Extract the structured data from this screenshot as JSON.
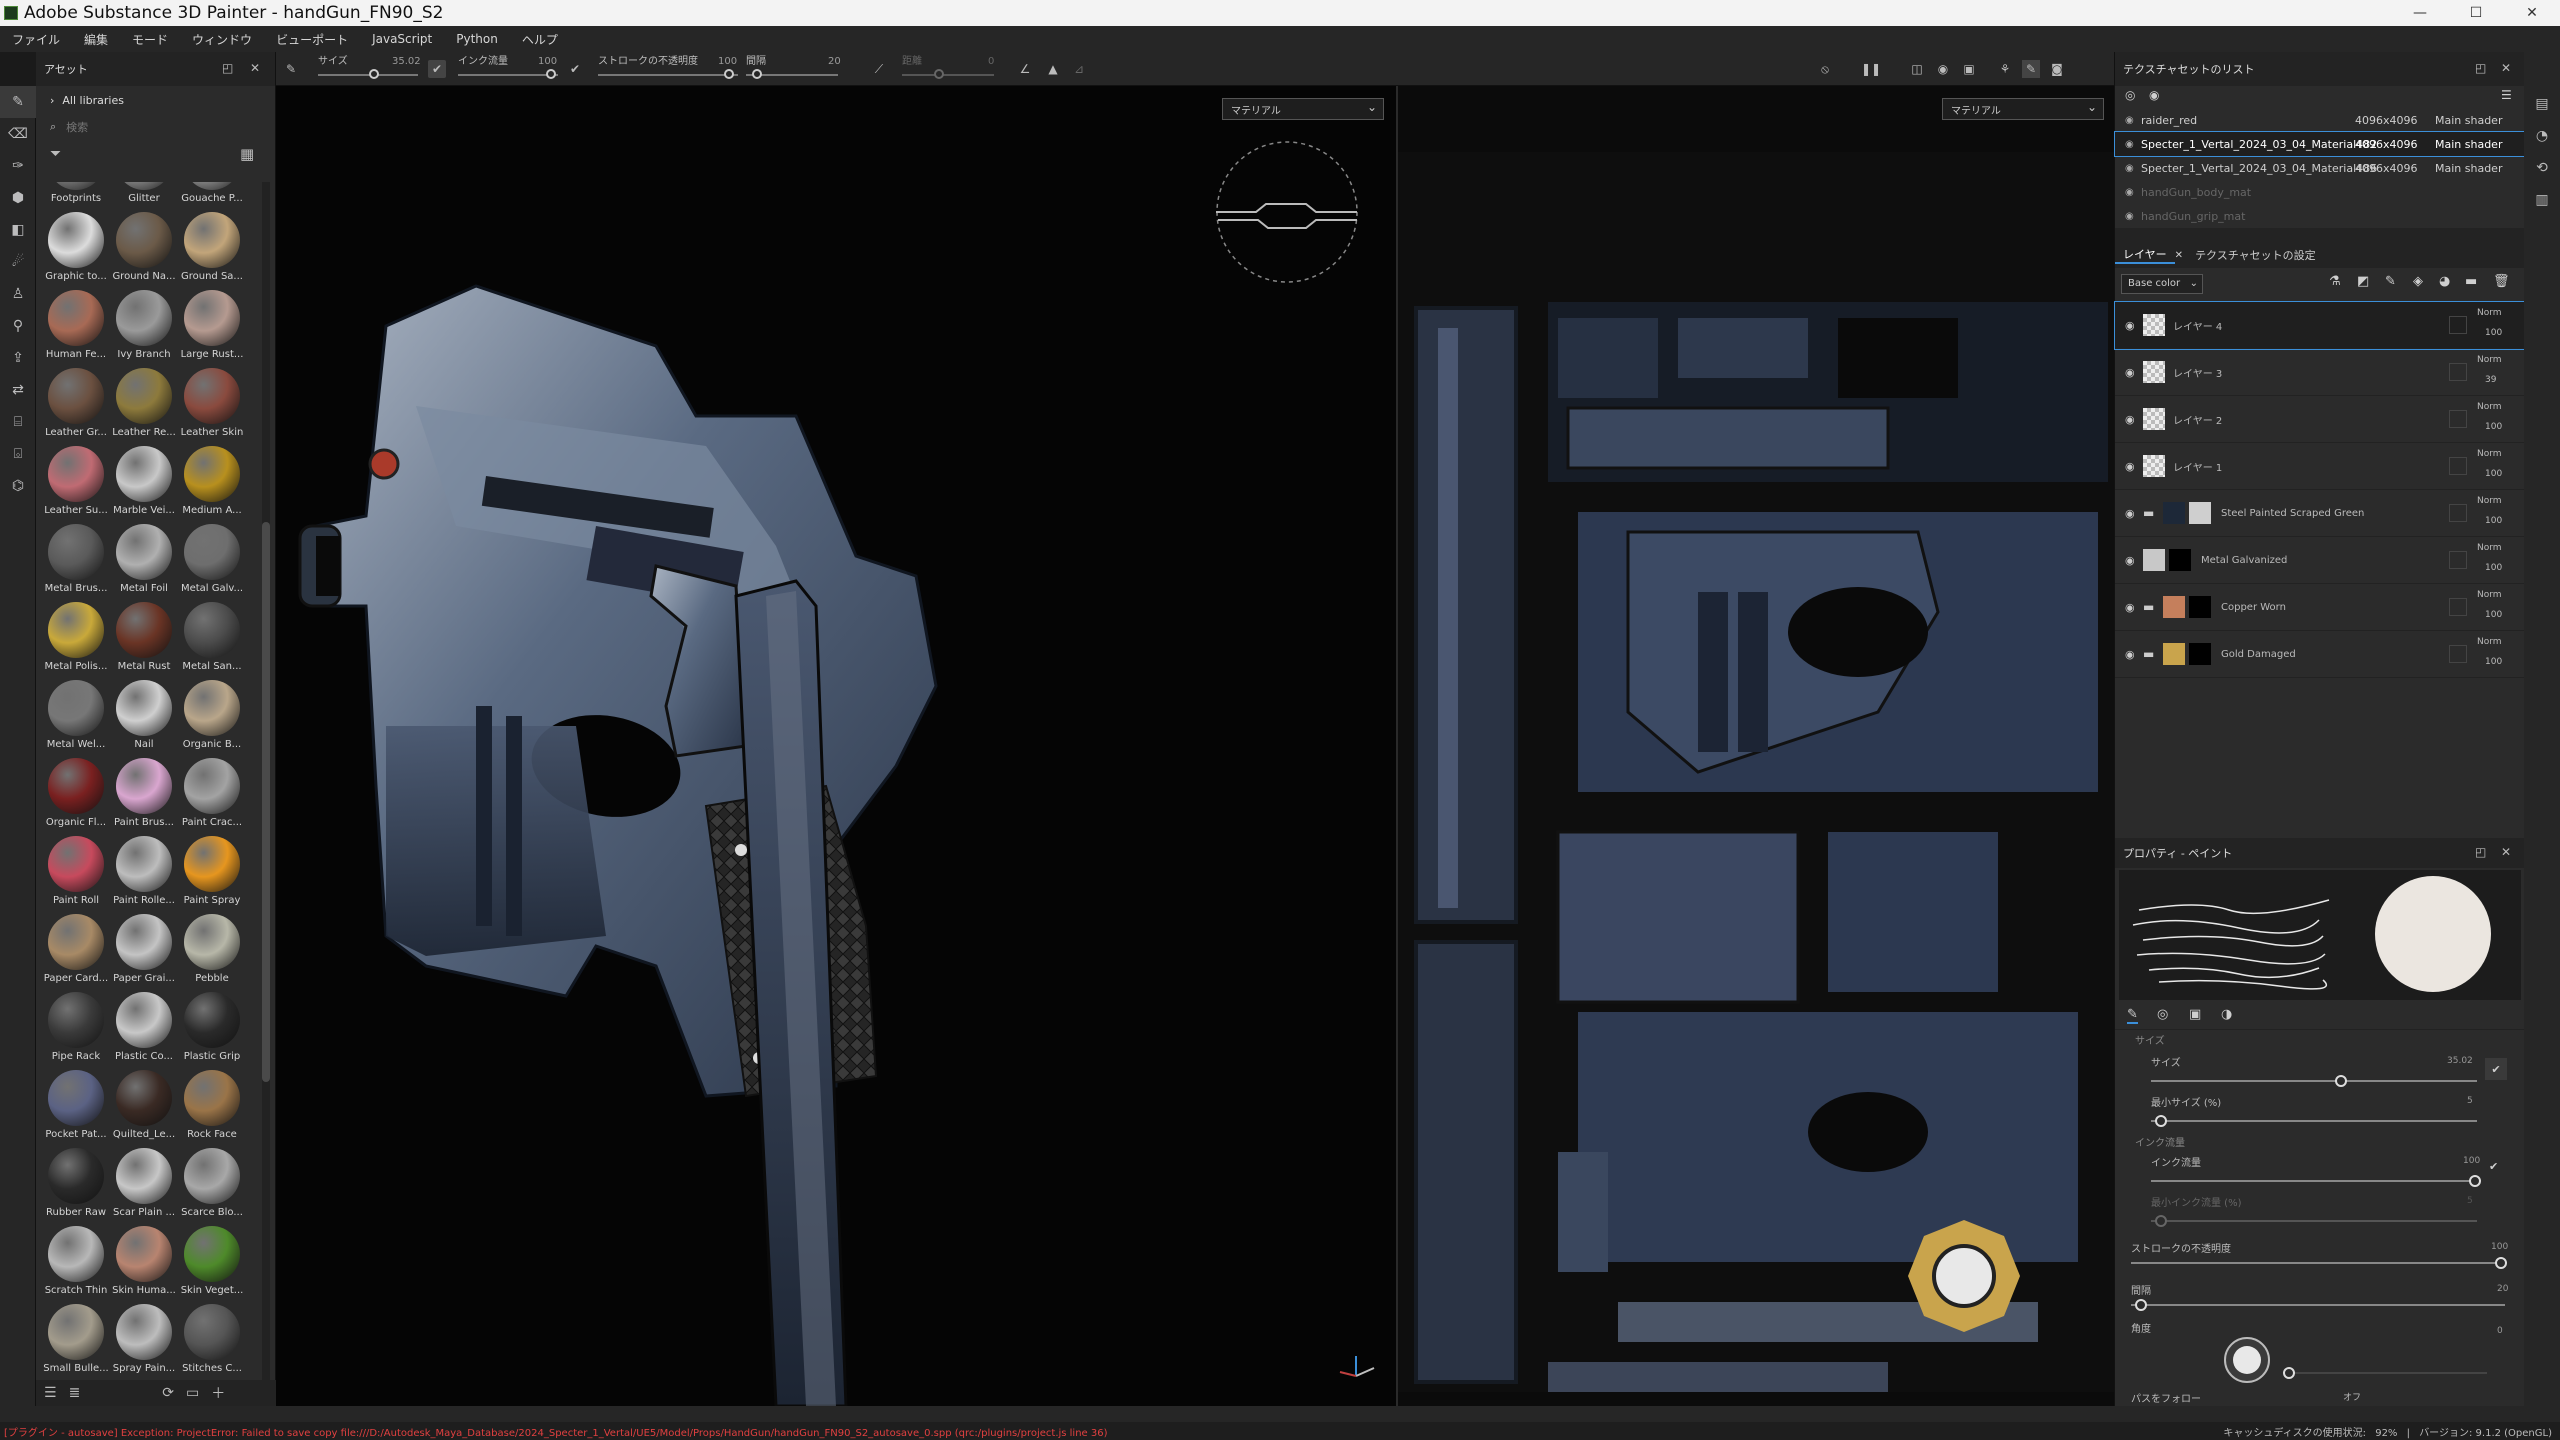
{
  "window": {
    "title": "Adobe Substance 3D Painter - handGun_FN90_S2"
  },
  "menu": [
    "ファイル",
    "編集",
    "モード",
    "ウィンドウ",
    "ビューポート",
    "JavaScript",
    "Python",
    "ヘルプ"
  ],
  "toolbar": {
    "size_label": "サイズ",
    "size_value": "35.02",
    "flow_label": "インク流量",
    "flow_value": "100",
    "stroke_label": "ストロークの不透明度",
    "stroke_value": "100",
    "spacing_label": "間隔",
    "spacing_value": "20",
    "jitter_label": "距離",
    "jitter_value": "0"
  },
  "assets": {
    "title": "アセット",
    "library": "All libraries",
    "search_placeholder": "検索",
    "items": [
      {
        "label": "Footprints",
        "color": "#8a8a8a"
      },
      {
        "label": "Glitter",
        "color": "#9b9b9b"
      },
      {
        "label": "Gouache P...",
        "color": "#a0a0a0"
      },
      {
        "label": "Graphic to...",
        "color": "#dcdcdc"
      },
      {
        "label": "Ground Na...",
        "color": "#6b5a48"
      },
      {
        "label": "Ground Sa...",
        "color": "#c2a57a"
      },
      {
        "label": "Human Fe...",
        "color": "#a86a55"
      },
      {
        "label": "Ivy Branch",
        "color": "#9a9a9a"
      },
      {
        "label": "Large Rust...",
        "color": "#b59a90"
      },
      {
        "label": "Leather Gr...",
        "color": "#6b5040"
      },
      {
        "label": "Leather Re...",
        "color": "#8d7a3c"
      },
      {
        "label": "Leather Skin",
        "color": "#8a4a3e"
      },
      {
        "label": "Leather Su...",
        "color": "#c06b73"
      },
      {
        "label": "Marble Vei...",
        "color": "#c8c8c8"
      },
      {
        "label": "Medium A...",
        "color": "#b8901e"
      },
      {
        "label": "Metal Brus...",
        "color": "#5a5a5a"
      },
      {
        "label": "Metal Foil",
        "color": "#b0b0b0"
      },
      {
        "label": "Metal Galv...",
        "color": "#6e6e6e"
      },
      {
        "label": "Metal Polis...",
        "color": "#c9a93a"
      },
      {
        "label": "Metal Rust",
        "color": "#6a3425"
      },
      {
        "label": "Metal San...",
        "color": "#4c4c4c"
      },
      {
        "label": "Metal Wel...",
        "color": "#777777"
      },
      {
        "label": "Nail",
        "color": "#cfcfcf"
      },
      {
        "label": "Organic B...",
        "color": "#b9a68a"
      },
      {
        "label": "Organic Fl...",
        "color": "#7a2020"
      },
      {
        "label": "Paint Brus...",
        "color": "#d9a6cf"
      },
      {
        "label": "Paint Crac...",
        "color": "#a3a3a3"
      },
      {
        "label": "Paint Roll",
        "color": "#c74a5d"
      },
      {
        "label": "Paint Rolle...",
        "color": "#bdbdbd"
      },
      {
        "label": "Paint Spray",
        "color": "#e6961f"
      },
      {
        "label": "Paper Card...",
        "color": "#a88a66"
      },
      {
        "label": "Paper Grai...",
        "color": "#c4c4c4"
      },
      {
        "label": "Pebble",
        "color": "#b7b7a8"
      },
      {
        "label": "Pipe Rack",
        "color": "#3a3a3a"
      },
      {
        "label": "Plastic Co...",
        "color": "#c8c8c8"
      },
      {
        "label": "Plastic Grip",
        "color": "#2a2a2a"
      },
      {
        "label": "Pocket Pat...",
        "color": "#5b6284"
      },
      {
        "label": "Quilted_Le...",
        "color": "#3a2a24"
      },
      {
        "label": "Rock Face",
        "color": "#9a7448"
      },
      {
        "label": "Rubber Raw",
        "color": "#2a2a2a"
      },
      {
        "label": "Scar Plain ...",
        "color": "#c7c7c7"
      },
      {
        "label": "Scarce Blo...",
        "color": "#a8a8a8"
      },
      {
        "label": "Scratch Thin",
        "color": "#b8b8b8"
      },
      {
        "label": "Skin Huma...",
        "color": "#b88470"
      },
      {
        "label": "Skin Veget...",
        "color": "#4e8a2a"
      },
      {
        "label": "Small Bulle...",
        "color": "#a39c8c"
      },
      {
        "label": "Spray Pain...",
        "color": "#bdbdbd"
      },
      {
        "label": "Stitches C...",
        "color": "#555555"
      }
    ]
  },
  "viewport": {
    "material_dropdown_3d": "マテリアル",
    "material_dropdown_2d": "マテリアル"
  },
  "texture_sets": {
    "title": "テクスチャセットのリスト",
    "rows": [
      {
        "name": "raider_red",
        "res": "4096x4096",
        "shader": "Main shader",
        "active": false,
        "dim": false
      },
      {
        "name": "Specter_1_Vertal_2024_03_04_Material482",
        "res": "4096x4096",
        "shader": "Main shader",
        "active": true,
        "dim": false
      },
      {
        "name": "Specter_1_Vertal_2024_03_04_Material486",
        "res": "4096x4096",
        "shader": "Main shader",
        "active": false,
        "dim": false
      },
      {
        "name": "handGun_body_mat",
        "res": "",
        "shader": "",
        "active": false,
        "dim": true
      },
      {
        "name": "handGun_grip_mat",
        "res": "",
        "shader": "",
        "active": false,
        "dim": true
      }
    ]
  },
  "layers": {
    "tab_layers": "レイヤー",
    "tab_settings": "テクスチャセットの設定",
    "channel": "Base color",
    "rows": [
      {
        "name": "レイヤー 4",
        "blend": "Norm",
        "opacity": "100",
        "folder": false,
        "thumb": "#d8d8d8",
        "mask": ""
      },
      {
        "name": "レイヤー 3",
        "blend": "Norm",
        "opacity": "39",
        "folder": false,
        "thumb": "#d8d8d8",
        "mask": ""
      },
      {
        "name": "レイヤー 2",
        "blend": "Norm",
        "opacity": "100",
        "folder": false,
        "thumb": "#d8d8d8",
        "mask": ""
      },
      {
        "name": "レイヤー 1",
        "blend": "Norm",
        "opacity": "100",
        "folder": false,
        "thumb": "#d8d8d8",
        "mask": ""
      },
      {
        "name": "Steel Painted Scraped Green",
        "blend": "Norm",
        "opacity": "100",
        "folder": true,
        "thumb": "#1d2838",
        "mask": "#cfcfcf"
      },
      {
        "name": "Metal Galvanized",
        "blend": "Norm",
        "opacity": "100",
        "folder": false,
        "thumb": "#c8c8c8",
        "mask": "#000000"
      },
      {
        "name": "Copper Worn",
        "blend": "Norm",
        "opacity": "100",
        "folder": true,
        "thumb": "#c57f5c",
        "mask": "#000000"
      },
      {
        "name": "Gold Damaged",
        "blend": "Norm",
        "opacity": "100",
        "folder": true,
        "thumb": "#c9a44c",
        "mask": "#000000"
      }
    ]
  },
  "properties": {
    "title": "プロパティ - ペイント",
    "section_size": "サイズ",
    "size_label": "サイズ",
    "size_value": "35.02",
    "minsize_label": "最小サイズ (%)",
    "minsize_value": "5",
    "section_flow": "インク流量",
    "flow_label": "インク流量",
    "flow_value": "100",
    "minflow_label": "最小インク流量 (%)",
    "minflow_value": "5",
    "stroke_label": "ストロークの不透明度",
    "stroke_value": "100",
    "spacing_label": "間隔",
    "spacing_value": "20",
    "angle_label": "角度",
    "angle_value": "0",
    "follow_label": "パスをフォロー",
    "follow_value": "オフ"
  },
  "status": {
    "error": "[プラグイン - autosave] Exception: ProjectError: Failed to save copy file:///D:/Autodesk_Maya_Database/2024_Specter_1_Vertal/UE5/Model/Props/HandGun/handGun_FN90_S2_autosave_0.spp (qrc:/plugins/project.js line 36)",
    "cache": "キャッシュディスクの使用状況:",
    "cache_value": "92%",
    "version": "バージョン: 9.1.2 (OpenGL)"
  },
  "colors": {
    "accent": "#3b8fd9",
    "error": "#e04040",
    "panel": "#2b2b2b"
  }
}
